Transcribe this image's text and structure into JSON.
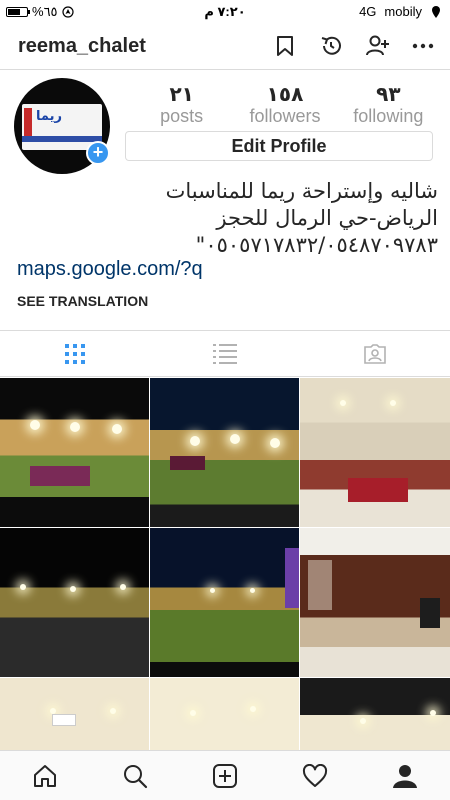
{
  "status_bar": {
    "battery_percent": "%٦٥",
    "battery_level": 0.65,
    "time": "٧:٢٠ م",
    "network": "4G",
    "carrier": "mobily",
    "location_icon": "location-arrow-icon"
  },
  "header": {
    "username": "reema_chalet",
    "icons": [
      "bookmark-icon",
      "archive-clock-icon",
      "add-person-icon",
      "more-icon"
    ]
  },
  "profile": {
    "avatar_text": "ريما",
    "stats": [
      {
        "number": "٢١",
        "label": "posts"
      },
      {
        "number": "١٥٨",
        "label": "followers"
      },
      {
        "number": "٩٣",
        "label": "following"
      }
    ],
    "edit_label": "Edit Profile",
    "bio_lines": [
      "شاليه وإستراحة ريما للمناسبات",
      "الرياض-حي الرمال للحجز",
      "٠٥٠٥٧١٧٨٣٢/٠٥٤٨٧٠٩٧٨٣\""
    ],
    "link": "maps.google.com/?q",
    "see_translation": "SEE TRANSLATION"
  },
  "tabs": [
    "grid-icon",
    "list-icon",
    "tagged-icon"
  ],
  "bottom_nav": [
    "home-icon",
    "search-icon",
    "add-post-icon",
    "heart-icon",
    "profile-icon"
  ],
  "colors": {
    "accent_blue": "#3897f0",
    "link_blue": "#003569",
    "text": "#262626",
    "muted": "#999999",
    "border": "#dbdbdb"
  }
}
